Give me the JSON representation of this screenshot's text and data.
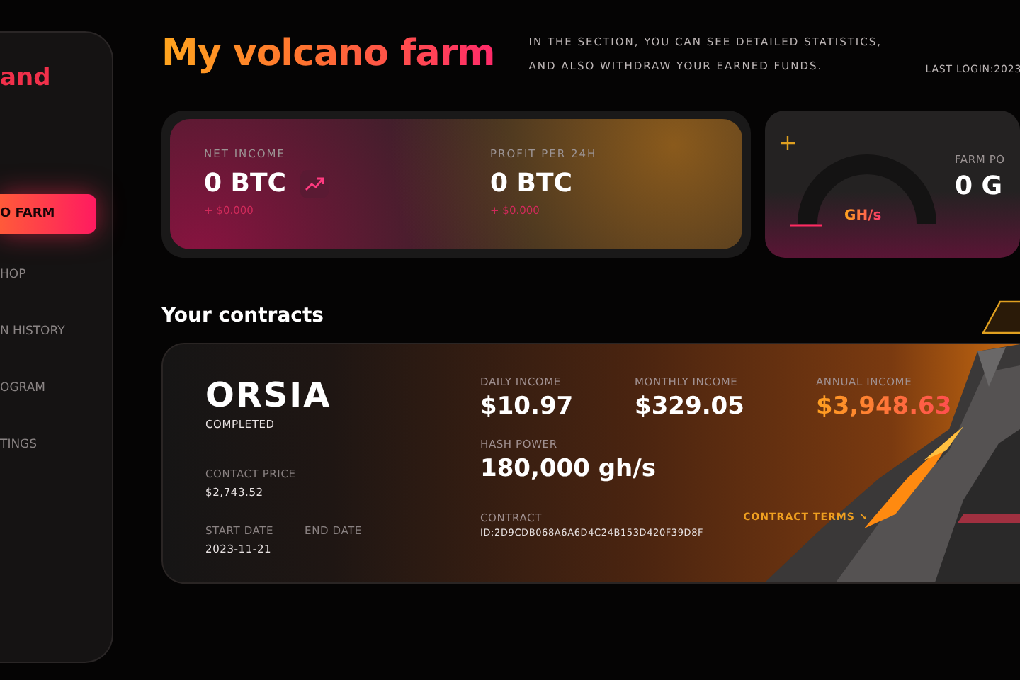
{
  "sidebar": {
    "logo": "and",
    "items": [
      {
        "label": "O FARM",
        "selected": true
      },
      {
        "label": "HOP",
        "selected": false
      },
      {
        "label": "N HISTORY",
        "selected": false
      },
      {
        "label": "OGRAM",
        "selected": false
      },
      {
        "label": "TINGS",
        "selected": false
      }
    ]
  },
  "header": {
    "title": "My volcano farm",
    "description": "IN THE SECTION, YOU CAN SEE DETAILED STATISTICS, AND ALSO WITHDRAW YOUR EARNED FUNDS.",
    "last_login": "LAST LOGIN:2023"
  },
  "income": [
    {
      "label": "NET INCOME",
      "value": "0 BTC",
      "change": "+ $0.000",
      "trend": true
    },
    {
      "label": "PROFIT PER 24H",
      "value": "0 BTC",
      "change": "+ $0.000",
      "trend": false
    }
  ],
  "farm": {
    "unit": "GH/s",
    "label": "FARM PO",
    "value": "0 G"
  },
  "contracts_title": "Your contracts",
  "contract": {
    "name": "ORSIA",
    "status": "COMPLETED",
    "price_label": "CONTACT PRICE",
    "price": "$2,743.52",
    "start_label": "START DATE",
    "start": "2023-11-21",
    "end_label": "END DATE",
    "incomes": [
      {
        "label": "DAILY INCOME",
        "value": "$10.97",
        "highlight": false
      },
      {
        "label": "MONTHLY INCOME",
        "value": "$329.05",
        "highlight": false
      },
      {
        "label": "ANNUAL INCOME",
        "value": "$3,948.63",
        "highlight": true
      }
    ],
    "hash_label": "HASH POWER",
    "hash": "180,000 gh/s",
    "id_label": "CONTRACT",
    "id": "ID:2D9CDB068A6A6D4C24B153D420F39D8F",
    "terms": "CONTRACT TERMS ↘"
  }
}
